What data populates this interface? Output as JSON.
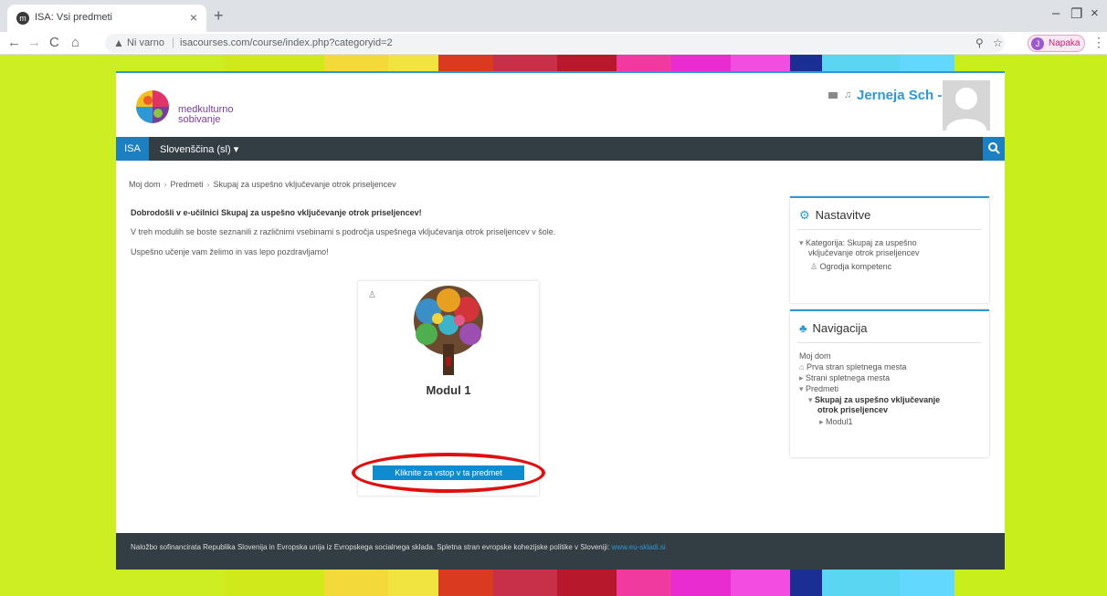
{
  "browser": {
    "tab_title": "ISA: Vsi predmeti",
    "tab_favicon": "m",
    "new_tab": "+",
    "tab_close": "×",
    "back": "←",
    "forward": "→",
    "reload": "C",
    "home": "⌂",
    "warning_icon": "▲",
    "security_label": "Ni varno",
    "url": "isacourses.com/course/index.php?categoryid=2",
    "zoom_icon": "⚲",
    "star_icon": "☆",
    "profile_initial": "J",
    "profile_label": "Napaka",
    "menu": "⋮",
    "minimize": "–",
    "restore": "❐",
    "close": "×"
  },
  "stripe_colors": [
    "#ccee22",
    "#ccee22",
    "#ccee22",
    "#ccee22",
    "#cfe91a",
    "#f4d93a",
    "#f2e440",
    "#d93a20",
    "#c8304a",
    "#b8182c",
    "#f03aa0",
    "#e82ccf",
    "#f34ce0",
    "#1a2e94",
    "#5ad5f2",
    "#62d8ff",
    "#c8ef1c"
  ],
  "stripe_widths": [
    75,
    60,
    50,
    60,
    110,
    70,
    55,
    60,
    70,
    65,
    60,
    65,
    65,
    35,
    85,
    60,
    167
  ],
  "header": {
    "logo_text_line1": "medkulturno",
    "logo_text_line2": "sobivanje",
    "user_name": "Jerneja Sch -"
  },
  "nav": {
    "isa": "ISA",
    "language": "Slovenščina (sl) ▾",
    "search_icon": "search-icon"
  },
  "breadcrumb": [
    "Moj dom",
    "Predmeti",
    "Skupaj za uspešno vključevanje otrok priseljencev"
  ],
  "main": {
    "welcome": "Dobrodošli v e-učilnici Skupaj za uspešno vključevanje otrok priseljencev!",
    "intro": "V treh modulih se boste seznanili z različnimi vsebinami s področja uspešnega vključevanja otrok priseljencev v šole.",
    "greeting": "Uspešno učenje vam želimo in vas lepo pozdravljamo!"
  },
  "course": {
    "title": "Modul 1",
    "enter_button": "Kliknite za vstop v ta predmet"
  },
  "settings_block": {
    "title": "Nastavitve",
    "category_line1": "Kategorija: Skupaj za uspešno",
    "category_line2": "vključevanje otrok priseljencev",
    "competency": "Ogrodja kompetenc"
  },
  "navigation_block": {
    "title": "Navigacija",
    "home": "Moj dom",
    "front_page": "Prva stran spletnega mesta",
    "site_pages": "Strani spletnega mesta",
    "courses": "Predmeti",
    "current_line1": "Skupaj za uspešno vključevanje",
    "current_line2": "otrok priseljencev",
    "module": "Modul1"
  },
  "footer": {
    "text": "Naložbo sofinancirata Republika Slovenija in Evropska unija iz Evropskega socialnega sklada. Spletna stran evropske kohezijske politike v Sloveniji:",
    "link": "www.eu-skladi.si"
  }
}
